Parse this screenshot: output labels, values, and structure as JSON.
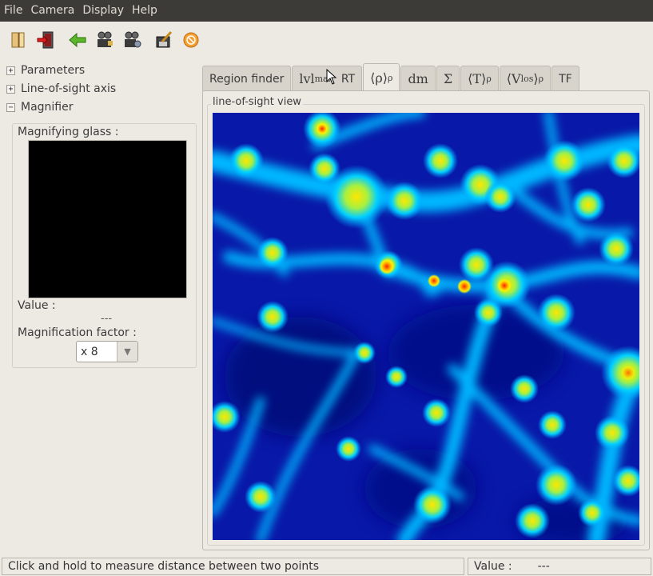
{
  "menubar": {
    "items": [
      "File",
      "Camera",
      "Display",
      "Help"
    ]
  },
  "toolbar": {
    "icons": [
      "open-book-icon",
      "exit-icon",
      "back-arrow-icon",
      "camera-people-icon",
      "camera-settings-icon",
      "save-pen-icon",
      "stop-icon"
    ]
  },
  "left_panel": {
    "tree": [
      {
        "expander": "+",
        "label": "Parameters"
      },
      {
        "expander": "+",
        "label": "Line-of-sight axis"
      },
      {
        "expander": "−",
        "label": "Magnifier"
      }
    ],
    "magnifier": {
      "glass_label": "Magnifying glass :",
      "value_label": "Value :",
      "value": "---",
      "factor_label": "Magnification factor :",
      "factor_selected": "x 8"
    }
  },
  "tabs": [
    {
      "label": "Region finder",
      "math": false
    },
    {
      "label": "lvl",
      "sub": "max",
      "suffix": "RT",
      "math": true
    },
    {
      "label": "⟨ρ⟩",
      "sub": "ρ",
      "math": true,
      "active": true
    },
    {
      "label": "dm",
      "math": true
    },
    {
      "label": "Σ",
      "math": true
    },
    {
      "label": "⟨T⟩",
      "sub": "ρ",
      "math": true
    },
    {
      "label": "⟨V",
      "sub2": "los",
      "after": "⟩",
      "sub": "ρ",
      "math": true
    },
    {
      "label": "TF",
      "math": false
    }
  ],
  "view": {
    "frame_title": "line-of-sight view"
  },
  "statusbar": {
    "message": "Click and hold to measure distance between two points",
    "value_label": "Value :",
    "value": "---"
  },
  "colors": {
    "menubar_bg": "#3c3b37",
    "window_bg": "#edeae4",
    "colormap_low": "#0a12a0",
    "colormap_mid": "#00d8ff",
    "colormap_high": "#ffe000",
    "colormap_peak": "#ff2000"
  }
}
